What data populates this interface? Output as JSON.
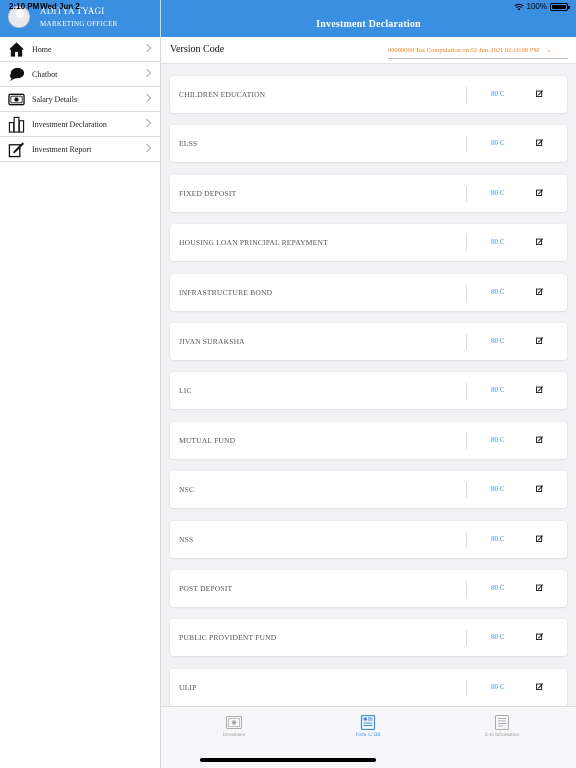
{
  "status_bar": {
    "time": "2:10 PM",
    "date": "Wed Jun 2",
    "battery": "100%"
  },
  "sidebar": {
    "user_name": "ADITYA TYAGI",
    "user_role": "MARKETING OFFICER",
    "items": [
      {
        "label": "Home",
        "icon": "home-icon"
      },
      {
        "label": "Chatbot",
        "icon": "chat-icon"
      },
      {
        "label": "Salary Details",
        "icon": "money-icon"
      },
      {
        "label": "Investment Declaration",
        "icon": "buildings-icon"
      },
      {
        "label": "Investment Report",
        "icon": "edit-report-icon"
      }
    ]
  },
  "main": {
    "title": "Investment Declaration",
    "version_label": "Version Code",
    "version_value": "00000000 Tax Computation on 02-Jun-2021 02:10:00 PM",
    "investments": [
      {
        "name": "CHILDREN EDUCATION",
        "section": "80 C"
      },
      {
        "name": "ELSS",
        "section": "80 C"
      },
      {
        "name": "FIXED DEPOSIT",
        "section": "80 C"
      },
      {
        "name": "HOUSING LOAN PRINCIPAL REPAYMENT",
        "section": "80 C"
      },
      {
        "name": "INFRASTRUCTURE BOND",
        "section": "80 C"
      },
      {
        "name": "JIVAN SURAKSHA",
        "section": "80 C"
      },
      {
        "name": "LIC",
        "section": "80 C"
      },
      {
        "name": "MUTUAL FUND",
        "section": "80 C"
      },
      {
        "name": "NSC",
        "section": "80 C"
      },
      {
        "name": "NSS",
        "section": "80 C"
      },
      {
        "name": "POST DEPOSIT",
        "section": "80 C"
      },
      {
        "name": "PUBLIC PROVIDENT FUND",
        "section": "80 C"
      },
      {
        "name": "ULIP",
        "section": "80 C"
      }
    ]
  },
  "tabbar": {
    "tabs": [
      {
        "label": "Investment",
        "icon": "money-icon",
        "active": false
      },
      {
        "label": "Form 12 BB",
        "icon": "form-icon",
        "active": true
      },
      {
        "label": "E-In Information",
        "icon": "document-icon",
        "active": false
      }
    ]
  },
  "colors": {
    "accent": "#3b8fe0",
    "version_text": "#f0811f"
  }
}
